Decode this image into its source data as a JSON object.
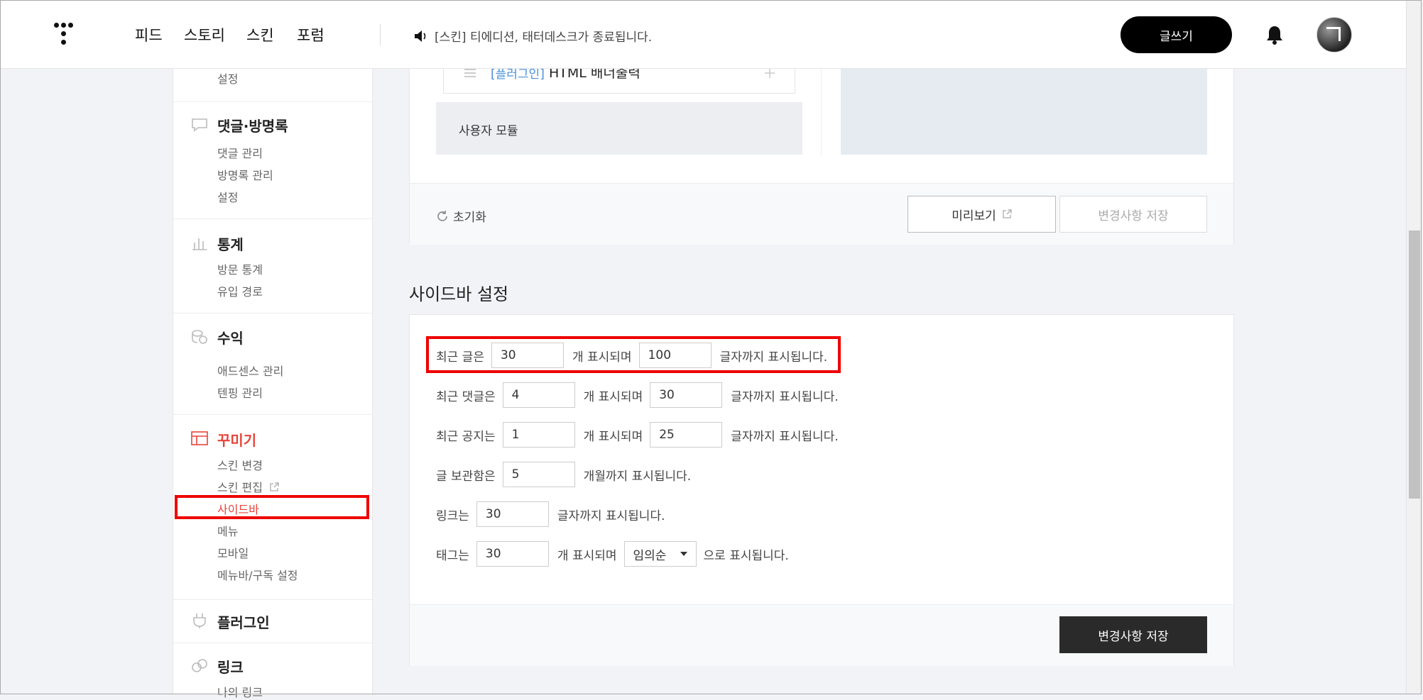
{
  "topnav": {
    "items": [
      "피드",
      "스토리",
      "스킨",
      "포럼"
    ],
    "notice": "[스킨] 티에디션, 태터데스크가 종료됩니다.",
    "write_label": "글쓰기"
  },
  "sidebar": {
    "top_sub": "설정",
    "comments": {
      "title": "댓글·방명록",
      "items": [
        "댓글 관리",
        "방명록 관리",
        "설정"
      ]
    },
    "stats": {
      "title": "통계",
      "items": [
        "방문 통계",
        "유입 경로"
      ]
    },
    "revenue": {
      "title": "수익",
      "items": [
        "애드센스 관리",
        "텐핑 관리"
      ]
    },
    "decorate": {
      "title": "꾸미기",
      "items": [
        "스킨 변경",
        "스킨 편집",
        "사이드바",
        "메뉴",
        "모바일",
        "메뉴바/구독 설정"
      ]
    },
    "plugin": {
      "title": "플러그인"
    },
    "link": {
      "title": "링크",
      "items": [
        "나의 링크"
      ]
    }
  },
  "module_panel": {
    "plugin_tag": "[플러그인]",
    "plugin_name": "HTML 배너출력",
    "user_module": "사용자 모듈",
    "reset_label": "초기화",
    "preview_label": "미리보기",
    "save_label": "변경사항 저장"
  },
  "sidebar_settings": {
    "title": "사이드바 설정",
    "rows": {
      "recent_posts": {
        "label": "최근 글은",
        "count": "30",
        "mid": "개 표시되며",
        "chars": "100",
        "suffix": "글자까지 표시됩니다."
      },
      "recent_comments": {
        "label": "최근 댓글은",
        "count": "4",
        "mid": "개 표시되며",
        "chars": "30",
        "suffix": "글자까지 표시됩니다."
      },
      "recent_notices": {
        "label": "최근 공지는",
        "count": "1",
        "mid": "개 표시되며",
        "chars": "25",
        "suffix": "글자까지 표시됩니다."
      },
      "archive": {
        "label": "글 보관함은",
        "count": "5",
        "suffix": "개월까지 표시됩니다."
      },
      "links": {
        "label": "링크는",
        "chars": "30",
        "suffix": "글자까지 표시됩니다."
      },
      "tags": {
        "label": "태그는",
        "count": "30",
        "mid": "개 표시되며",
        "order": "임의순",
        "suffix": "으로 표시됩니다."
      }
    },
    "save_label": "변경사항 저장"
  },
  "colors": {
    "accent": "#e8433a",
    "highlight": "#ee0000",
    "dark_button": "#2a2a2a",
    "link_blue": "#4a90d9"
  }
}
